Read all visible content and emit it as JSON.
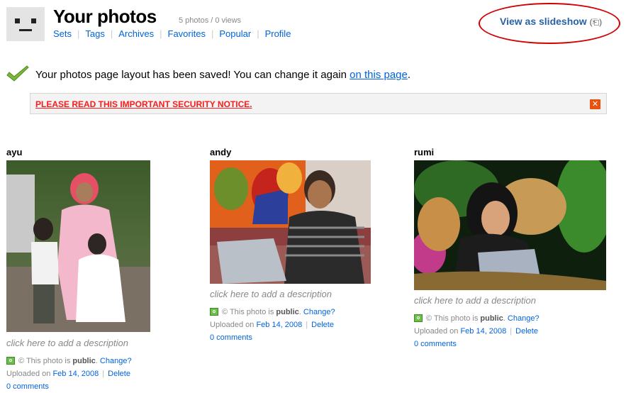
{
  "header": {
    "title": "Your photos",
    "stats": "5 photos / 0 views",
    "nav": [
      "Sets",
      "Tags",
      "Archives",
      "Favorites",
      "Popular",
      "Profile"
    ],
    "slideshow_label": "View as slideshow",
    "slideshow_icon": "(⎗)"
  },
  "saved": {
    "message": "Your photos page layout has been saved! You can change it again ",
    "link": "on this page",
    "end": "."
  },
  "notice": {
    "text": "PLEASE READ THIS IMPORTANT SECURITY NOTICE.",
    "close": "✕"
  },
  "photos": [
    {
      "title": "ayu",
      "description": "click here to add a description",
      "privacy_prefix": "© This photo is ",
      "privacy_word": "public",
      "change": "Change?",
      "uploaded_prefix": "Uploaded on ",
      "date": "Feb 14, 2008",
      "delete": "Delete",
      "comments": "0 comments"
    },
    {
      "title": "andy",
      "description": "click here to add a description",
      "privacy_prefix": "© This photo is ",
      "privacy_word": "public",
      "change": "Change?",
      "uploaded_prefix": "Uploaded on ",
      "date": "Feb 14, 2008",
      "delete": "Delete",
      "comments": "0 comments"
    },
    {
      "title": "rumi",
      "description": "click here to add a description",
      "privacy_prefix": "© This photo is ",
      "privacy_word": "public",
      "change": "Change?",
      "uploaded_prefix": "Uploaded on ",
      "date": "Feb 14, 2008",
      "delete": "Delete",
      "comments": "0 comments"
    }
  ],
  "colors": {
    "link": "#0063dc",
    "notice_red": "#ff1a1a",
    "highlight_circle": "#d40000",
    "close_button": "#e8520e"
  },
  "icons": {
    "buddy": "buddy-icon",
    "saved": "checkmark-icon",
    "close": "close-icon",
    "public": "public-icon"
  }
}
